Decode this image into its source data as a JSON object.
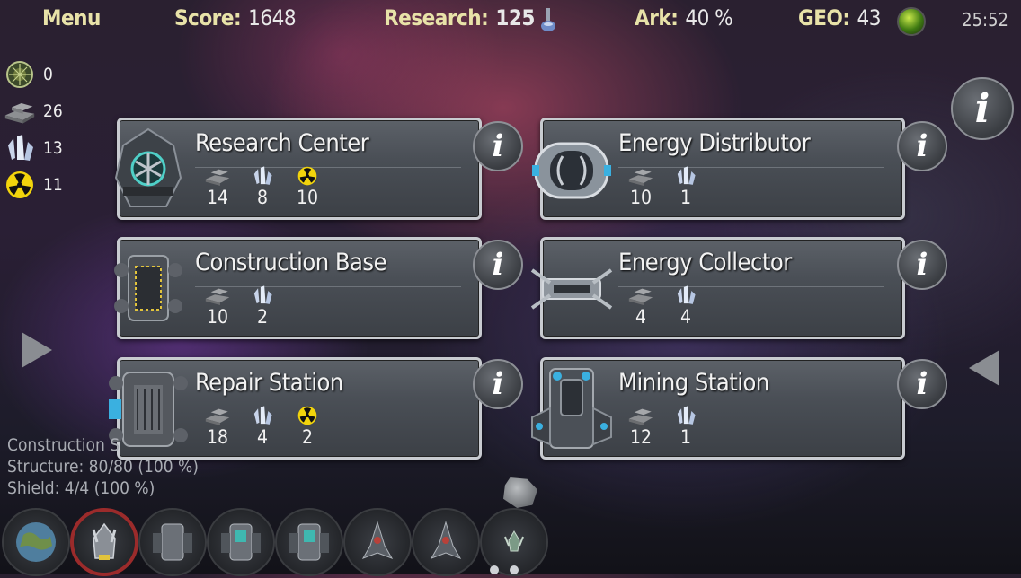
{
  "topbar": {
    "menu_label": "Menu",
    "score_label": "Score:",
    "score_value": "1648",
    "research_label": "Research:",
    "research_value": "125",
    "ark_label": "Ark:",
    "ark_value": "40 %",
    "geo_label": "GEO:",
    "geo_value": "43",
    "clock": "25:52"
  },
  "resources": [
    {
      "icon": "geo-crystal-icon",
      "value": "0"
    },
    {
      "icon": "metal-ingot-icon",
      "value": "26"
    },
    {
      "icon": "ice-crystal-icon",
      "value": "13"
    },
    {
      "icon": "radiation-icon",
      "value": "11"
    }
  ],
  "buildings": [
    {
      "name": "Research Center",
      "costs": [
        "14",
        "8",
        "10"
      ]
    },
    {
      "name": "Energy Distributor",
      "costs": [
        "10",
        "1"
      ]
    },
    {
      "name": "Construction Base",
      "costs": [
        "10",
        "2"
      ]
    },
    {
      "name": "Energy Collector",
      "costs": [
        "4",
        "4"
      ]
    },
    {
      "name": "Repair Station",
      "costs": [
        "18",
        "4",
        "2"
      ]
    },
    {
      "name": "Mining Station",
      "costs": [
        "12",
        "1"
      ]
    }
  ],
  "info_label": "i",
  "status": {
    "line1": "Construction S",
    "line2": "Structure: 80/80 (100 %)",
    "line3": "Shield: 4/4 (100 %)"
  },
  "colors": {
    "label_yellow": "#e8e2a8",
    "selected_ring": "#9b2b2b",
    "panel_border": "#c8cbd0",
    "radiation_yellow": "#f2d40c"
  }
}
